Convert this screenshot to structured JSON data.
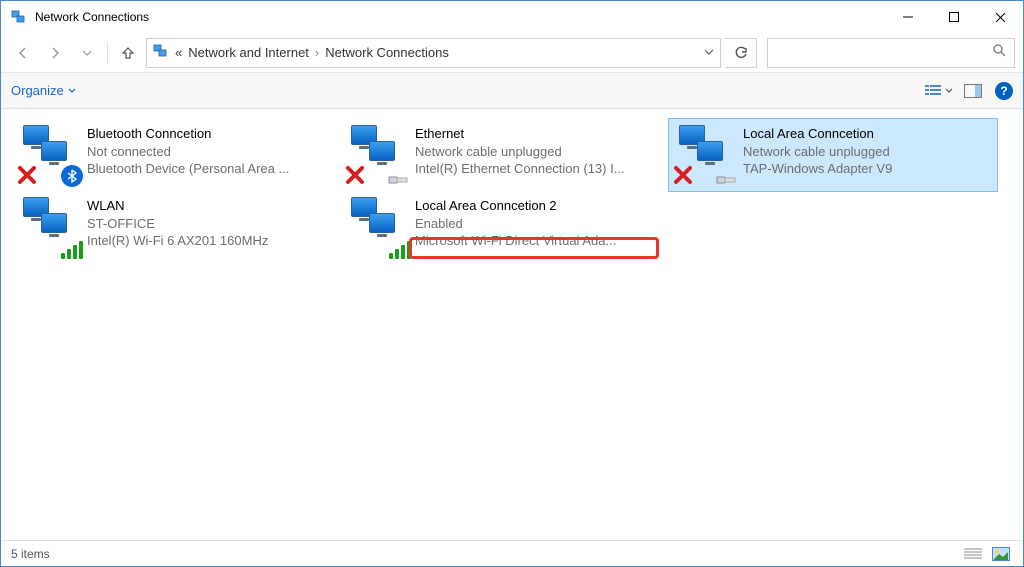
{
  "window": {
    "title": "Network Connections"
  },
  "breadcrumb": {
    "prefix": "«",
    "part1": "Network and Internet",
    "part2": "Network Connections"
  },
  "cmdbar": {
    "organize": "Organize"
  },
  "connections": [
    {
      "name": "Bluetooth Conncetion",
      "status": "Not connected",
      "device": "Bluetooth Device (Personal Area ...",
      "overlayLeft": "x",
      "overlayRight": "bt",
      "selected": false,
      "highlight": false
    },
    {
      "name": "Ethernet",
      "status": "Network cable unplugged",
      "device": "Intel(R) Ethernet Connection (13) I...",
      "overlayLeft": "x",
      "overlayRight": "cable",
      "selected": false,
      "highlight": false
    },
    {
      "name": "Local Area Conncetion",
      "status": "Network cable unplugged",
      "device": "TAP-Windows Adapter V9",
      "overlayLeft": "x",
      "overlayRight": "cable",
      "selected": true,
      "highlight": false
    },
    {
      "name": "WLAN",
      "status": "ST-OFFICE",
      "device": "Intel(R) Wi-Fi 6 AX201 160MHz",
      "overlayLeft": "",
      "overlayRight": "wifi",
      "selected": false,
      "highlight": false
    },
    {
      "name": "Local Area Conncetion 2",
      "status": "Enabled",
      "device": "Microsoft Wi-Fi Direct Virtual Ada...",
      "overlayLeft": "",
      "overlayRight": "wifi",
      "selected": false,
      "highlight": true
    }
  ],
  "statusbar": {
    "count_text": "5 items"
  }
}
